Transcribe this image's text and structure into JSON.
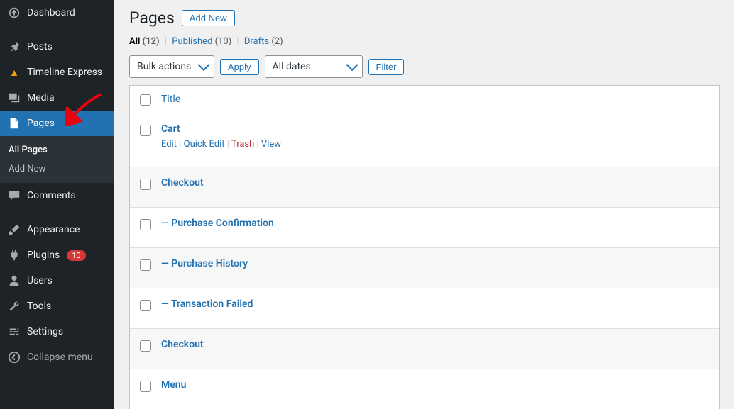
{
  "sidebar": {
    "items": [
      {
        "label": "Dashboard",
        "icon": "dashboard"
      },
      {
        "label": "Posts",
        "icon": "pin"
      },
      {
        "label": "Timeline Express",
        "icon": "te"
      },
      {
        "label": "Media",
        "icon": "media"
      },
      {
        "label": "Pages",
        "icon": "page"
      },
      {
        "label": "Comments",
        "icon": "comment"
      },
      {
        "label": "Appearance",
        "icon": "brush"
      },
      {
        "label": "Plugins",
        "icon": "plug",
        "badge": "10"
      },
      {
        "label": "Users",
        "icon": "user"
      },
      {
        "label": "Tools",
        "icon": "wrench"
      },
      {
        "label": "Settings",
        "icon": "sliders"
      },
      {
        "label": "Collapse menu",
        "icon": "collapse"
      }
    ],
    "submenu": [
      {
        "label": "All Pages",
        "current": true
      },
      {
        "label": "Add New",
        "current": false
      }
    ]
  },
  "header": {
    "title": "Pages",
    "add_new": "Add New"
  },
  "filters": {
    "all": {
      "label": "All",
      "count": "(12)"
    },
    "published": {
      "label": "Published",
      "count": "(10)"
    },
    "drafts": {
      "label": "Drafts",
      "count": "(2)"
    }
  },
  "toolbar": {
    "bulk": "Bulk actions",
    "apply": "Apply",
    "dates": "All dates",
    "filter": "Filter"
  },
  "table": {
    "col_title": "Title",
    "rows": [
      {
        "title": "Cart",
        "actions": true
      },
      {
        "title": "Checkout"
      },
      {
        "title": "— Purchase Confirmation"
      },
      {
        "title": "— Purchase History"
      },
      {
        "title": "— Transaction Failed"
      },
      {
        "title": "Checkout"
      },
      {
        "title": "Menu"
      }
    ],
    "actions": {
      "edit": "Edit",
      "quick": "Quick Edit",
      "trash": "Trash",
      "view": "View"
    }
  }
}
